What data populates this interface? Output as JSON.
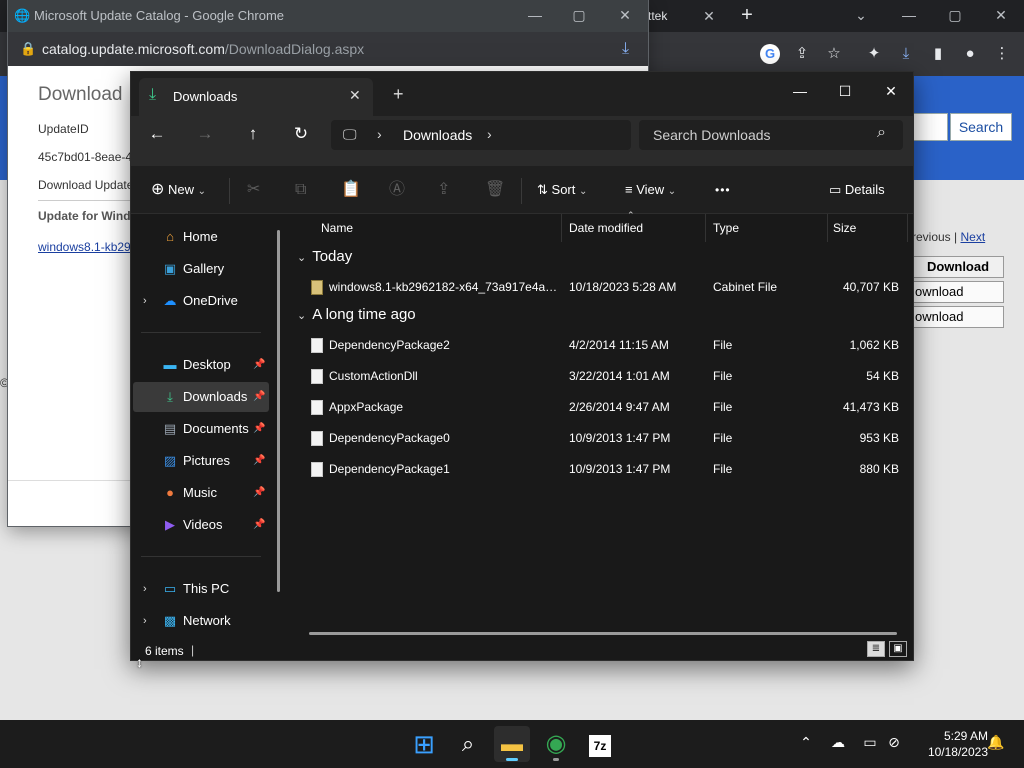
{
  "chrome_bg": {
    "tab_partial": "ttek",
    "tab_close": "✕",
    "new_tab": "+",
    "win_min": "—",
    "win_max": "▢",
    "win_close": "✕",
    "ctl_dropdown": "⌄",
    "site_search_label": "Search",
    "pager": {
      "previous": "revious",
      "separator": " | ",
      "next": "Next"
    },
    "download_header": "Download",
    "download_rows": [
      "ownload",
      "ownload"
    ],
    "left_fragment": "©"
  },
  "popup": {
    "window_title": "Microsoft Update Catalog - Google Chrome",
    "url_host": "catalog.update.microsoft.com",
    "url_path": "/DownloadDialog.aspx",
    "win_min": "—",
    "win_max": "▢",
    "win_close": "✕",
    "heading": "Download",
    "update_id_label": "UpdateID",
    "update_id_value": "45c7bd01-8eae-4",
    "download_update_label": "Download Update",
    "update_for_label": "Update for Wind",
    "link_text": "windows8.1-kb29"
  },
  "explorer": {
    "tab_title": "Downloads",
    "tab_close": "✕",
    "new_tab": "+",
    "win_min": "—",
    "win_max": "☐",
    "win_close": "✕",
    "nav": {
      "back": "←",
      "forward": "→",
      "up": "↑",
      "refresh": "↻"
    },
    "address": {
      "monitor": "🖵",
      "sep1": "›",
      "location": "Downloads",
      "sep2": "›"
    },
    "search_placeholder": "Search Downloads",
    "search_glyph": "⌕",
    "commands": {
      "new_label": "New",
      "new_glyph": "⊕",
      "chev": "⌄",
      "cut": "✂",
      "copy": "⧉",
      "paste": "📋",
      "rename": "Ⓐ",
      "share": "⇪",
      "delete": "🗑",
      "sort_label": "Sort",
      "sort_glyph": "⇅",
      "view_label": "View",
      "view_glyph": "≡",
      "more": "•••",
      "details_label": "Details",
      "details_glyph": "▭"
    },
    "nav_pane": [
      {
        "key": "home",
        "label": "Home",
        "icon": "⌂",
        "color": "#f0a33c"
      },
      {
        "key": "gallery",
        "label": "Gallery",
        "icon": "▣",
        "color": "#3a9fd8"
      },
      {
        "key": "onedrive",
        "label": "OneDrive",
        "icon": "☁",
        "color": "#1e90ff",
        "chevron": "›"
      },
      {
        "key": "desktop",
        "label": "Desktop",
        "icon": "▬",
        "color": "#3ab4f2",
        "pin": "📌"
      },
      {
        "key": "downloads",
        "label": "Downloads",
        "icon": "⤓",
        "color": "#3ec98d",
        "pin": "📌"
      },
      {
        "key": "documents",
        "label": "Documents",
        "icon": "▤",
        "color": "#9aa6b2",
        "pin": "📌"
      },
      {
        "key": "pictures",
        "label": "Pictures",
        "icon": "▨",
        "color": "#3a8fe6",
        "pin": "📌"
      },
      {
        "key": "music",
        "label": "Music",
        "icon": "●",
        "color": "#f07a3e",
        "pin": "📌"
      },
      {
        "key": "videos",
        "label": "Videos",
        "icon": "▶",
        "color": "#8e5cf0",
        "pin": "📌"
      },
      {
        "key": "thispc",
        "label": "This PC",
        "icon": "▭",
        "color": "#3ab4f2",
        "chevron": "›"
      },
      {
        "key": "network",
        "label": "Network",
        "icon": "▩",
        "color": "#3ab4f2",
        "chevron": "›"
      }
    ],
    "columns": {
      "name": "Name",
      "date": "Date modified",
      "type": "Type",
      "size": "Size",
      "sort_indicator": "⌃"
    },
    "groups": {
      "today": {
        "label": "Today",
        "caret": "⌄"
      },
      "older": {
        "label": "A long time ago",
        "caret": "⌄"
      }
    },
    "files_today": [
      {
        "name": "windows8.1-kb2962182-x64_73a917e4aea...",
        "date": "10/18/2023 5:28 AM",
        "type": "Cabinet File",
        "size": "40,707 KB"
      }
    ],
    "files_older": [
      {
        "name": "DependencyPackage2",
        "date": "4/2/2014 11:15 AM",
        "type": "File",
        "size": "1,062 KB"
      },
      {
        "name": "CustomActionDll",
        "date": "3/22/2014 1:01 AM",
        "type": "File",
        "size": "54 KB"
      },
      {
        "name": "AppxPackage",
        "date": "2/26/2014 9:47 AM",
        "type": "File",
        "size": "41,473 KB"
      },
      {
        "name": "DependencyPackage0",
        "date": "10/9/2013 1:47 PM",
        "type": "File",
        "size": "953 KB"
      },
      {
        "name": "DependencyPackage1",
        "date": "10/9/2013 1:47 PM",
        "type": "File",
        "size": "880 KB"
      }
    ],
    "status": {
      "count": "6 items",
      "caret": "|",
      "view_details": "≣",
      "view_tiles": "▣"
    }
  },
  "taskbar": {
    "start": "⊞",
    "search": "⌕",
    "explorer": "▬",
    "chrome": "◉",
    "sevenzip": "7z",
    "tray_chevron": "⌃",
    "tray_cloud": "☁",
    "tray_display": "▭",
    "tray_net": "⊘",
    "notifications": "🔔",
    "time": "5:29 AM",
    "date": "10/18/2023"
  },
  "colors": {
    "explorer_bg": "#191919",
    "accent": "#60cdff",
    "link": "#1a3fa0",
    "catalog_blue": "#2a62c8"
  }
}
